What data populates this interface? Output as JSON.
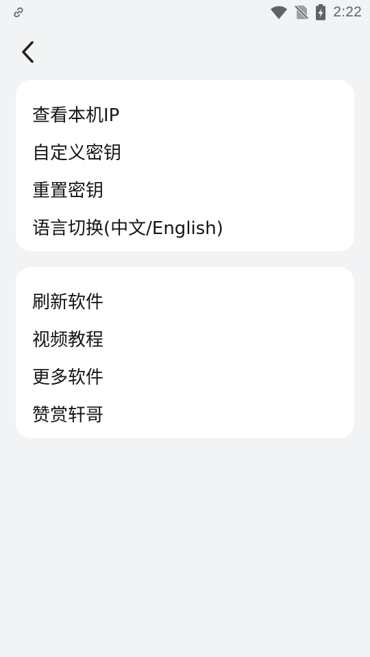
{
  "status_bar": {
    "time": "2:22",
    "icons": [
      "link-icon",
      "wifi-icon",
      "no-sim-icon",
      "battery-charging-icon"
    ]
  },
  "header": {
    "back_icon": "chevron-left-icon"
  },
  "sections": [
    {
      "items": [
        {
          "label": "查看本机IP"
        },
        {
          "label": "自定义密钥"
        },
        {
          "label": "重置密钥"
        },
        {
          "label": "语言切换(中文/English)"
        }
      ]
    },
    {
      "items": [
        {
          "label": "刷新软件"
        },
        {
          "label": "视频教程"
        },
        {
          "label": "更多软件"
        },
        {
          "label": "赞赏轩哥"
        }
      ]
    }
  ],
  "colors": {
    "background": "#f2f3f5",
    "card": "#ffffff",
    "text": "#151515",
    "status_icon": "#5f6368"
  }
}
